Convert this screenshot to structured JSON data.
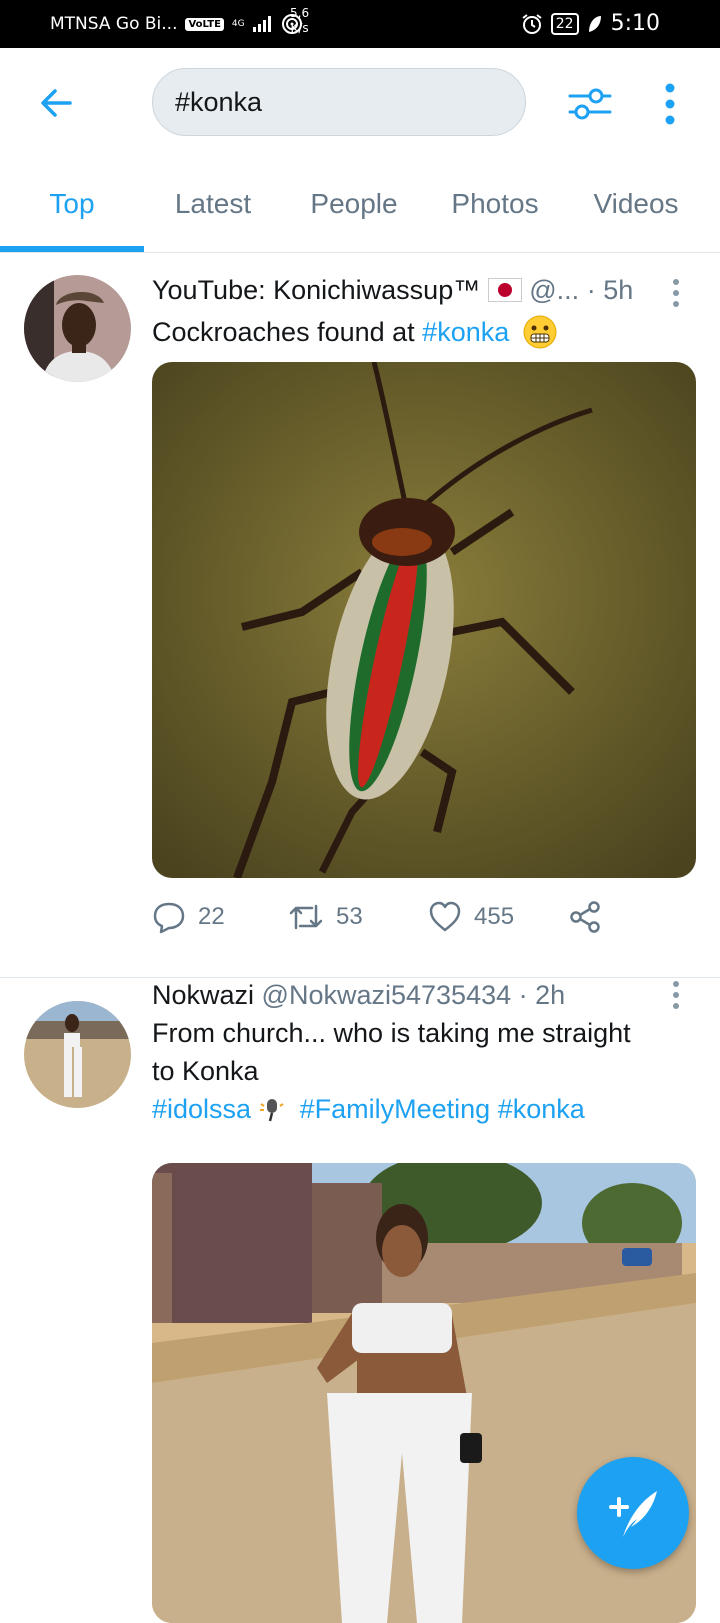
{
  "status_bar": {
    "carrier": "MTNSA Go Bi...",
    "volte": "VoLTE",
    "network": "4G",
    "speed_top": "5,6",
    "speed_bottom": "K/s",
    "battery": "22",
    "time": "5:10"
  },
  "search": {
    "query": "#konka"
  },
  "tabs": [
    {
      "label": "Top",
      "active": true
    },
    {
      "label": "Latest"
    },
    {
      "label": "People"
    },
    {
      "label": "Photos"
    },
    {
      "label": "Videos"
    }
  ],
  "tweets": [
    {
      "name": "YouTube: Konichiwassup™",
      "flag_icon": "japan-flag-icon",
      "handle": "@...",
      "time": "5h",
      "text_plain": "Cockroaches found at ",
      "hashtag": "#konka",
      "emoji_icon": "grimacing-face-emoji",
      "replies": "22",
      "retweets": "53",
      "likes": "455",
      "media": "Photo of a cockroach patterned with Gucci-style stripes"
    },
    {
      "name": "Nokwazi",
      "handle": "@Nokwazi54735434",
      "time": "2h",
      "text_line1": "From church... who is taking me straight",
      "text_line2": "to Konka",
      "hashtag1": "#idolssa",
      "hashtag2": "#FamilyMeeting",
      "hashtag3": "#konka",
      "emoji_icon": "microphone-emoji",
      "media": "Photo of a woman in a white outfit standing on a street"
    }
  ],
  "colors": {
    "accent": "#1da1f2",
    "text": "#14171a",
    "muted": "#657786",
    "divider": "#e1e8ed"
  },
  "fab": {
    "icon": "compose-tweet-icon",
    "plus": "+"
  }
}
